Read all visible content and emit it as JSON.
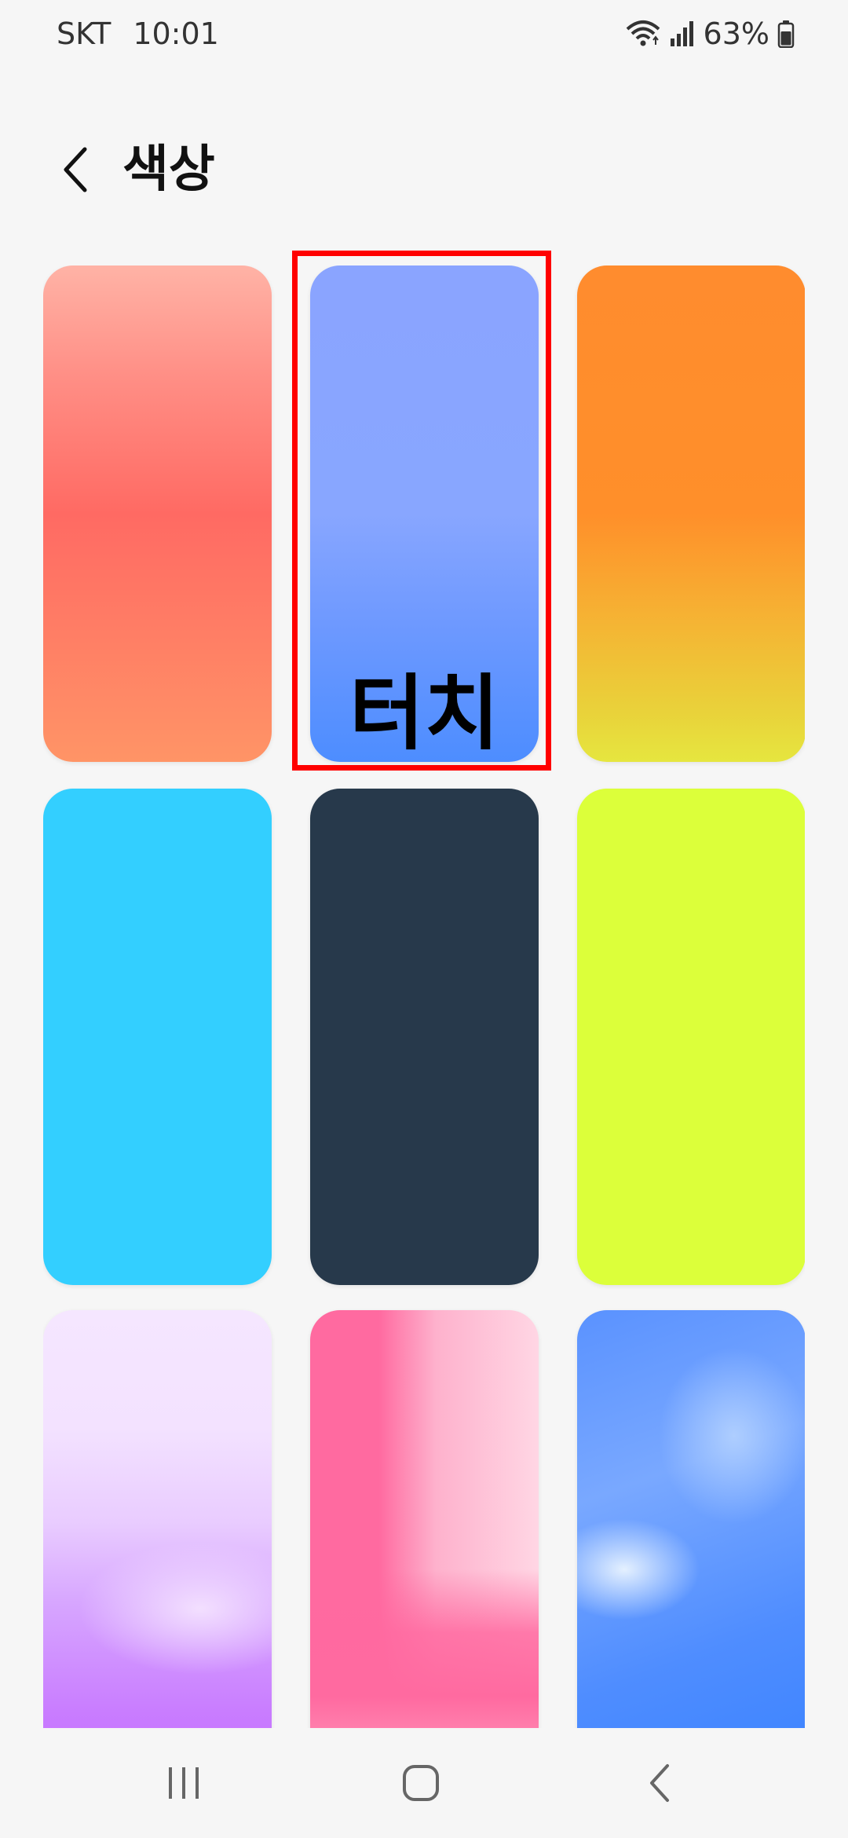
{
  "status_bar": {
    "carrier": "SKT",
    "time": "10:01",
    "battery_percent": "63%",
    "icons": [
      "wifi-icon",
      "signal-icon",
      "battery-icon"
    ]
  },
  "header": {
    "back_icon": "chevron-left-icon",
    "title": "색상"
  },
  "colors": {
    "selection_outline": "#ff0000",
    "background": "#f6f6f6"
  },
  "swatches": [
    {
      "name": "coral-gradient",
      "colors": [
        "#ffb3a6",
        "#ff6a63",
        "#ff9466"
      ]
    },
    {
      "name": "blue-gradient",
      "colors": [
        "#8aa4ff",
        "#4d8dff"
      ],
      "selected": true
    },
    {
      "name": "orange-yellow-gradient",
      "colors": [
        "#ff8c2e",
        "#e6e63f"
      ]
    },
    {
      "name": "cyan",
      "colors": [
        "#33cfff"
      ]
    },
    {
      "name": "navy",
      "colors": [
        "#27394b"
      ]
    },
    {
      "name": "lime",
      "colors": [
        "#dcff3a"
      ]
    },
    {
      "name": "lavender-wave",
      "colors": [
        "#f5e6ff",
        "#c46bff"
      ]
    },
    {
      "name": "pink-blur",
      "colors": [
        "#ff6aa0",
        "#ffd6e4"
      ]
    },
    {
      "name": "sky-blur",
      "colors": [
        "#5a92ff",
        "#ebf5ff"
      ]
    }
  ],
  "annotation": {
    "label": "터치"
  },
  "nav_bar": {
    "icons": [
      "recent-apps-icon",
      "home-icon",
      "back-icon"
    ]
  }
}
